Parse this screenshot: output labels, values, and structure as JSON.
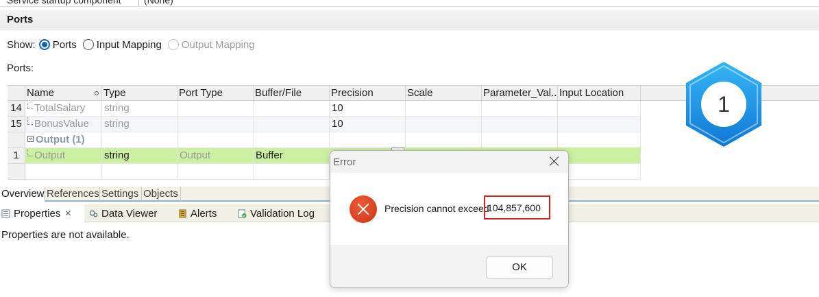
{
  "top": {
    "cut_label": "Service startup component",
    "cut_value": "(None)"
  },
  "section": {
    "title": "Ports"
  },
  "show": {
    "label": "Show:",
    "options": [
      {
        "label": "Ports",
        "selected": true,
        "enabled": true
      },
      {
        "label": "Input Mapping",
        "selected": false,
        "enabled": true
      },
      {
        "label": "Output Mapping",
        "selected": false,
        "enabled": false
      }
    ]
  },
  "ports_label": "Ports:",
  "grid": {
    "columns": [
      "Name",
      "Type",
      "Port Type",
      "Buffer/File",
      "Precision",
      "Scale",
      "Parameter_Val...",
      "Input Location"
    ],
    "rows": [
      {
        "num": "14",
        "name": "TotalSalary",
        "type": "string",
        "port_type": "",
        "buffer": "",
        "precision": "10"
      },
      {
        "num": "15",
        "name": "BonusValue",
        "type": "string",
        "port_type": "",
        "buffer": "",
        "precision": "10"
      },
      {
        "group": "Output (1)"
      },
      {
        "num": "1",
        "name": "Output",
        "type": "string",
        "port_type": "Output",
        "buffer": "Buffer",
        "precision": ""
      }
    ]
  },
  "subtabs": [
    "Overview",
    "References",
    "Settings",
    "Objects"
  ],
  "views": [
    {
      "label": "Properties",
      "active": true,
      "icon": "properties-icon"
    },
    {
      "label": "Data Viewer",
      "active": false,
      "icon": "data-viewer-icon"
    },
    {
      "label": "Alerts",
      "active": false,
      "icon": "alerts-icon"
    },
    {
      "label": "Validation Log",
      "active": false,
      "icon": "validation-log-icon"
    }
  ],
  "properties_message": "Properties are not available.",
  "dialog": {
    "title": "Error",
    "message": "Precision cannot exceed",
    "value": "104,857,600",
    "ok_label": "OK"
  },
  "badge": {
    "number": "1"
  },
  "colors": {
    "accent": "#1565c0",
    "row_highlight": "#ccf0a2",
    "error": "#d32222",
    "badge": "#1e9be8"
  }
}
